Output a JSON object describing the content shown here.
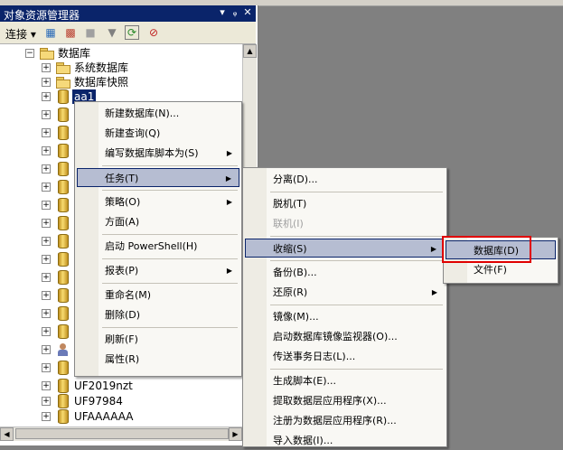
{
  "panel": {
    "title": "对象资源管理器",
    "title_controls": [
      "▾",
      "ᵩ",
      "✕"
    ],
    "connect_label": "连接 ▾"
  },
  "tree": {
    "root": "数据库",
    "system_db": "系统数据库",
    "snapshot": "数据库快照",
    "selected_db": "aa1",
    "bottom_items": [
      "UF2019nzt",
      "UF97984",
      "UFAAAAAA"
    ]
  },
  "context_menu": {
    "items": [
      {
        "label": "新建数据库(N)...",
        "submenu": false,
        "highlight": false
      },
      {
        "label": "新建查询(Q)",
        "submenu": false,
        "highlight": false
      },
      {
        "label": "编写数据库脚本为(S)",
        "submenu": true,
        "highlight": false
      },
      {
        "separator": true
      },
      {
        "label": "任务(T)",
        "submenu": true,
        "highlight": true
      },
      {
        "separator": true
      },
      {
        "label": "策略(O)",
        "submenu": true,
        "highlight": false
      },
      {
        "label": "方面(A)",
        "submenu": false,
        "highlight": false
      },
      {
        "separator": true
      },
      {
        "label": "启动 PowerShell(H)",
        "submenu": false,
        "highlight": false
      },
      {
        "separator": true
      },
      {
        "label": "报表(P)",
        "submenu": true,
        "highlight": false
      },
      {
        "separator": true
      },
      {
        "label": "重命名(M)",
        "submenu": false,
        "highlight": false
      },
      {
        "label": "删除(D)",
        "submenu": false,
        "highlight": false
      },
      {
        "separator": true
      },
      {
        "label": "刷新(F)",
        "submenu": false,
        "highlight": false
      },
      {
        "label": "属性(R)",
        "submenu": false,
        "highlight": false
      }
    ]
  },
  "tasks_menu": {
    "items": [
      {
        "label": "分离(D)...",
        "submenu": false,
        "highlight": false,
        "disabled": false
      },
      {
        "separator": true
      },
      {
        "label": "脱机(T)",
        "submenu": false,
        "highlight": false,
        "disabled": false
      },
      {
        "label": "联机(I)",
        "submenu": false,
        "highlight": false,
        "disabled": true
      },
      {
        "separator": true
      },
      {
        "label": "收缩(S)",
        "submenu": true,
        "highlight": true,
        "disabled": false
      },
      {
        "separator": true
      },
      {
        "label": "备份(B)...",
        "submenu": false,
        "highlight": false,
        "disabled": false
      },
      {
        "label": "还原(R)",
        "submenu": true,
        "highlight": false,
        "disabled": false
      },
      {
        "separator": true
      },
      {
        "label": "镜像(M)...",
        "submenu": false,
        "highlight": false,
        "disabled": false
      },
      {
        "label": "启动数据库镜像监视器(O)...",
        "submenu": false,
        "highlight": false,
        "disabled": false
      },
      {
        "label": "传送事务日志(L)...",
        "submenu": false,
        "highlight": false,
        "disabled": false
      },
      {
        "separator": true
      },
      {
        "label": "生成脚本(E)...",
        "submenu": false,
        "highlight": false,
        "disabled": false
      },
      {
        "label": "提取数据层应用程序(X)...",
        "submenu": false,
        "highlight": false,
        "disabled": false
      },
      {
        "label": "注册为数据层应用程序(R)...",
        "submenu": false,
        "highlight": false,
        "disabled": false
      },
      {
        "label": "导入数据(I)...",
        "submenu": false,
        "highlight": false,
        "disabled": false
      }
    ]
  },
  "shrink_menu": {
    "items": [
      {
        "label": "数据库(D)",
        "highlight": true
      },
      {
        "label": "文件(F)",
        "highlight": false
      }
    ]
  },
  "colors": {
    "highlight": "#b6bdd2",
    "title_bar": "#0a246a",
    "red_box": "#e00000"
  }
}
